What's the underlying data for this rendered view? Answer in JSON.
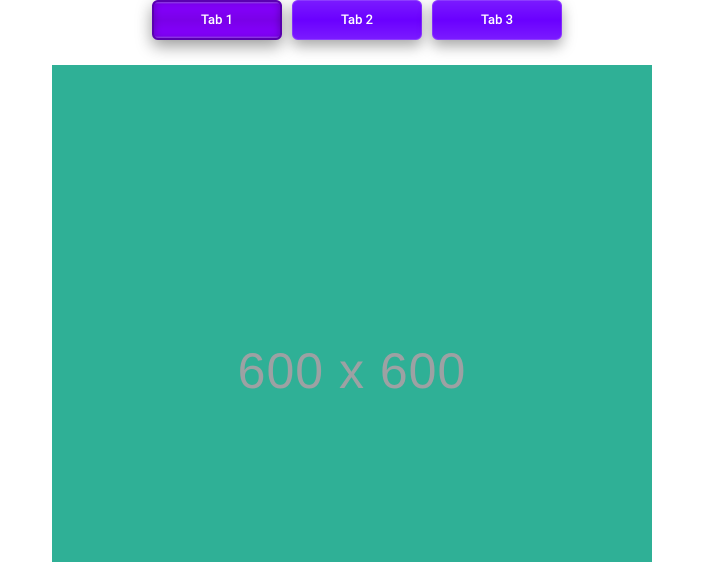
{
  "tabs": [
    {
      "label": "Tab 1",
      "active": true
    },
    {
      "label": "Tab 2",
      "active": false
    },
    {
      "label": "Tab 3",
      "active": false
    }
  ],
  "content": {
    "placeholder_text": "600 x 600"
  },
  "colors": {
    "tab_purple": "#7a00e8",
    "panel_teal": "#2fb096",
    "placeholder_gray": "#9da1a3"
  }
}
